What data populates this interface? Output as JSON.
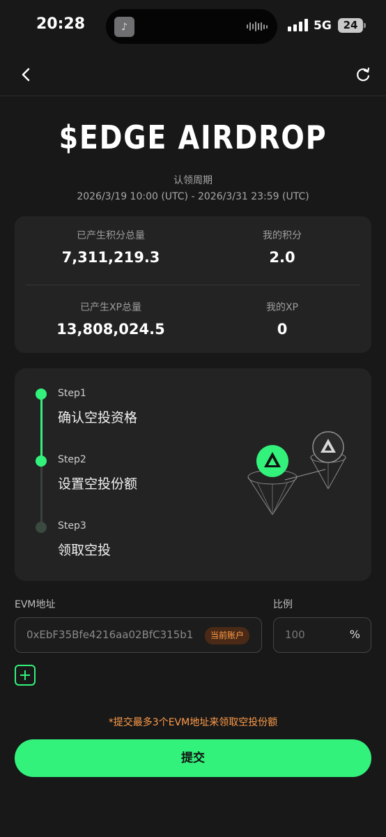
{
  "status_bar": {
    "time": "20:28",
    "network": "5G",
    "battery": "24"
  },
  "header": {
    "title": "$EDGE AIRDROP",
    "claim_period_label": "认领周期",
    "claim_period_range": "2026/3/19 10:00 (UTC) - 2026/3/31 23:59 (UTC)"
  },
  "stats": {
    "total_points_label": "已产生积分总量",
    "total_points_value": "7,311,219.3",
    "my_points_label": "我的积分",
    "my_points_value": "2.0",
    "total_xp_label": "已产生XP总量",
    "total_xp_value": "13,808,024.5",
    "my_xp_label": "我的XP",
    "my_xp_value": "0"
  },
  "steps": [
    {
      "num": "Step1",
      "title": "确认空投资格",
      "active": true
    },
    {
      "num": "Step2",
      "title": "设置空投份额",
      "active": true
    },
    {
      "num": "Step3",
      "title": "领取空投",
      "active": false
    }
  ],
  "form": {
    "evm_label": "EVM地址",
    "evm_value": "0xEbF35Bfe4216aa02BfC315b1",
    "current_account_badge": "当前账户",
    "ratio_label": "比例",
    "ratio_placeholder": "100",
    "ratio_unit": "%"
  },
  "note": "*提交最多3个EVM地址来领取空投份额",
  "submit_label": "提交",
  "colors": {
    "accent": "#33f27c",
    "warning": "#ff9c4a",
    "background": "#181818",
    "card": "#232323"
  }
}
